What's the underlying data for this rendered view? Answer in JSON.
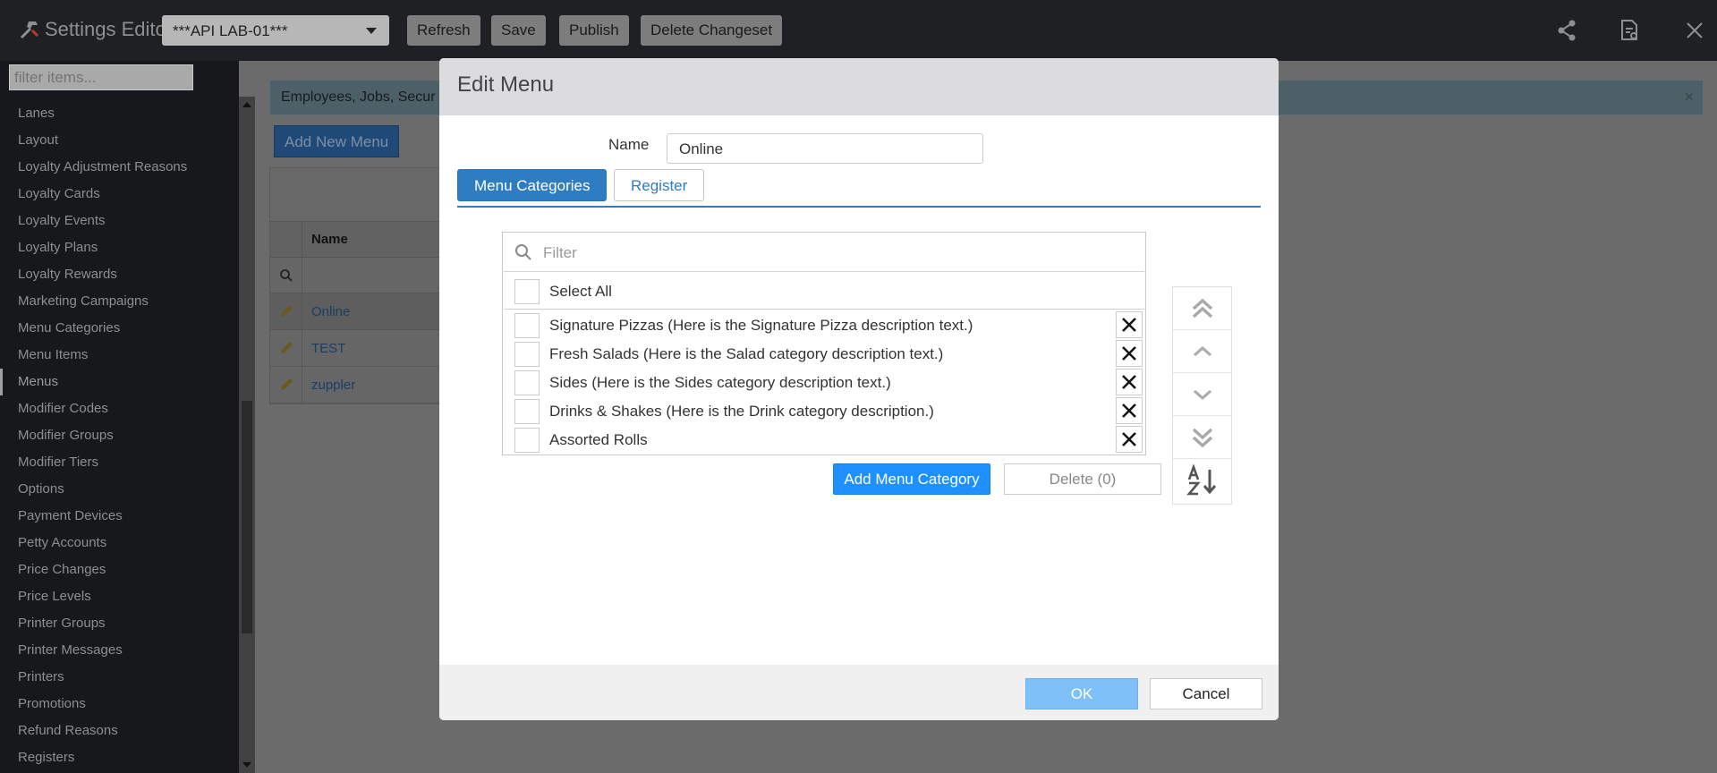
{
  "app": {
    "title": "Settings Editor",
    "environment": "***API LAB-01***"
  },
  "toolbar": {
    "refresh": "Refresh",
    "save": "Save",
    "publish": "Publish",
    "delete_changeset": "Delete Changeset"
  },
  "sidebar": {
    "filter_placeholder": "filter items...",
    "items": [
      "Lanes",
      "Layout",
      "Loyalty Adjustment Reasons",
      "Loyalty Cards",
      "Loyalty Events",
      "Loyalty Plans",
      "Loyalty Rewards",
      "Marketing Campaigns",
      "Menu Categories",
      "Menu Items",
      "Menus",
      "Modifier Codes",
      "Modifier Groups",
      "Modifier Tiers",
      "Options",
      "Payment Devices",
      "Petty Accounts",
      "Price Changes",
      "Price Levels",
      "Printer Groups",
      "Printer Messages",
      "Printers",
      "Promotions",
      "Refund Reasons",
      "Registers"
    ],
    "active_item": "Menus"
  },
  "background": {
    "banner_text": "Employees, Jobs, Secur",
    "add_new": "Add New Menu",
    "grid_header": "Name",
    "rows": [
      "Online",
      "TEST",
      "zuppler"
    ]
  },
  "modal": {
    "title": "Edit Menu",
    "name_label": "Name",
    "name_value": "Online",
    "tabs": [
      "Menu Categories",
      "Register"
    ],
    "active_tab": "Menu Categories",
    "filter_placeholder": "Filter",
    "select_all": "Select All",
    "categories": [
      "Signature Pizzas (Here is the Signature Pizza description text.)",
      "Fresh Salads (Here is the Salad category description text.)",
      "Sides (Here is the Sides category description text.)",
      "Drinks & Shakes (Here is the Drink category description.)",
      "Assorted Rolls"
    ],
    "add_category": "Add Menu Category",
    "delete": "Delete (0)",
    "ok": "OK",
    "cancel": "Cancel"
  },
  "colors": {
    "primary": "#2e7cc2",
    "add_button": "#1e90ff",
    "ok_button": "#7ec0f7",
    "topbar": "#1f2024",
    "sidebar": "#17181b"
  }
}
